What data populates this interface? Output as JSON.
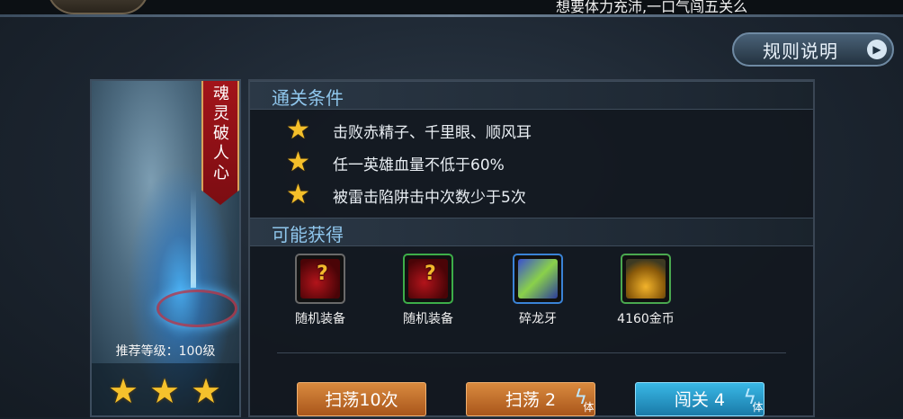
{
  "top_hint": "想要体力充沛,一口气闯五关么",
  "rules_button": {
    "label": "规则说明"
  },
  "stage": {
    "name_chars": [
      "魂",
      "灵",
      "破",
      "人",
      "心"
    ],
    "recommended_level": "推荐等级：100级",
    "stars_earned": 3
  },
  "conditions": {
    "title": "通关条件",
    "items": [
      {
        "text": "击败赤精子、千里眼、顺风耳"
      },
      {
        "text": "任一英雄血量不低于60%"
      },
      {
        "text": "被雷击陷阱击中次数少于5次"
      }
    ]
  },
  "rewards": {
    "title": "可能获得",
    "items": [
      {
        "name": "随机装备",
        "icon": "random-equipment-icon",
        "frame": "gray"
      },
      {
        "name": "随机装备",
        "icon": "random-equipment-icon",
        "frame": "green"
      },
      {
        "name": "碎龙牙",
        "icon": "dragon-tooth-icon",
        "frame": "blue"
      },
      {
        "name": "4160金币",
        "icon": "gold-coins-icon",
        "frame": "green"
      }
    ]
  },
  "actions": {
    "sweep10": "扫荡10次",
    "sweep": "扫荡 2",
    "challenge": "闯关 4",
    "stamina_glyph": "体"
  },
  "colors": {
    "accent": "#8fc6ec",
    "star": "#f4bf2a",
    "sweep_button": "#c97632",
    "challenge_button": "#2aa0d2"
  }
}
